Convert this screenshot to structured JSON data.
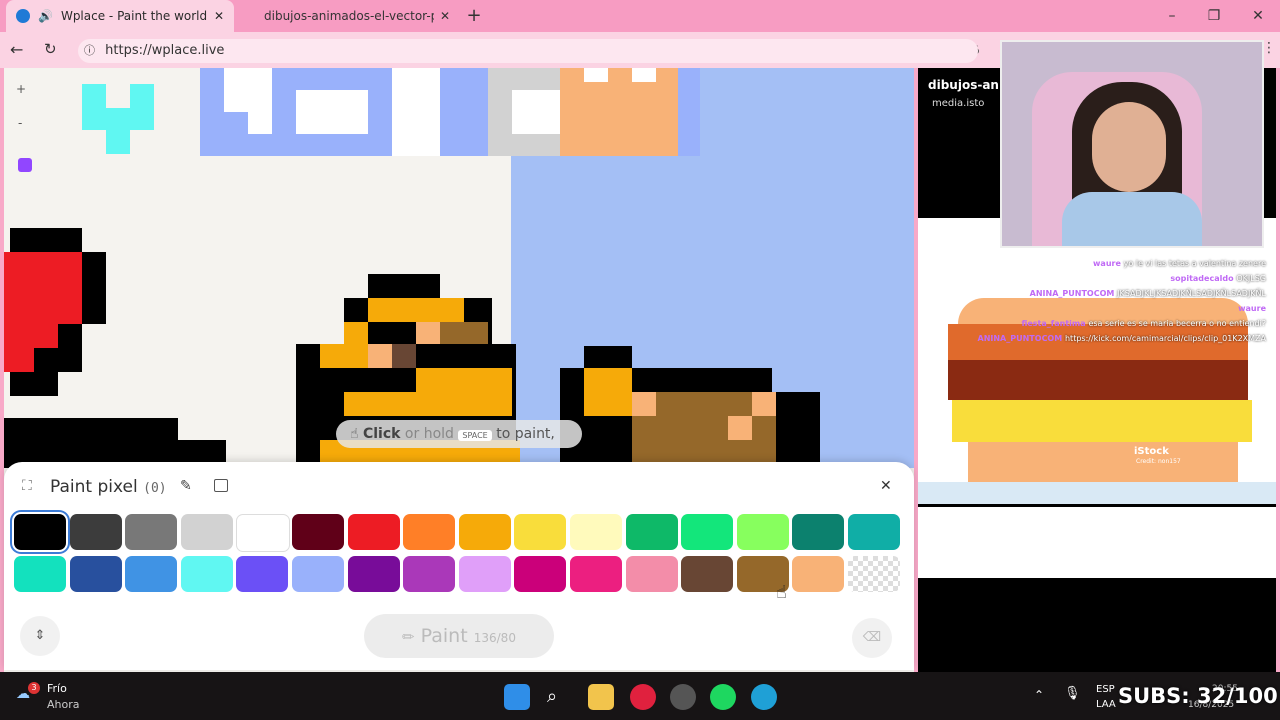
{
  "browser": {
    "tabs": [
      {
        "title": "Wplace - Paint the world"
      },
      {
        "title": "dibujos-animados-el-vector-pixel"
      }
    ],
    "url": "https://wplace.live",
    "new_tab_glyph": "+",
    "close_glyph": "✕"
  },
  "canvas": {
    "hint_click": "Click",
    "hint_or_hold": "or hold",
    "hint_space": "SPACE",
    "hint_to_paint": "to paint,"
  },
  "panel": {
    "title": "Paint pixel",
    "count": "(0)",
    "paint_label": "Paint",
    "paint_count": "136/80",
    "colors_row1": [
      "#000000",
      "#3c3c3c",
      "#787878",
      "#d2d2d2",
      "#ffffff",
      "#600018",
      "#ed1c24",
      "#ff7f27",
      "#f6aa09",
      "#f9dd3b",
      "#fffabc",
      "#0eb968",
      "#13e67b",
      "#87ff5e",
      "#0c816e",
      "#10aea6"
    ],
    "colors_row2": [
      "#13e1be",
      "#28509e",
      "#4093e4",
      "#60f7f2",
      "#6b50f6",
      "#99b1fb",
      "#780c99",
      "#aa38b9",
      "#e09ff9",
      "#cb007a",
      "#ec1f80",
      "#f38da9",
      "#684634",
      "#95682a",
      "#f8b277",
      "transparent"
    ]
  },
  "right": {
    "title": "dibujos-anim",
    "source": "media.isto",
    "istock": "iStock",
    "credit": "Credit: non157",
    "chat": [
      {
        "user": "waure",
        "msg": "yo le vi las tetas a valentina zenere"
      },
      {
        "user": "sopitadecaldo",
        "msg": "OKJLSG"
      },
      {
        "user": "ANINA_PUNTOCOM",
        "msg": "JKSADJKLJKSADJKÑLSADJKÑLSADJKÑL"
      },
      {
        "user": "waure",
        "msg": ""
      },
      {
        "user": "fiesta_fantima",
        "msg": "esa serie es se maria becerra o no entiendi?"
      },
      {
        "user": "ANINA_PUNTOCOM",
        "msg": "https://kick.com/camimarcial/clips/clip_01K2XMZA"
      }
    ]
  },
  "taskbar": {
    "weather_title": "Frío",
    "weather_sub": "Ahora",
    "weather_badge": "3",
    "lang1": "ESP",
    "lang2": "LAA",
    "subs": "SUBS: 32/100",
    "time": "20:55",
    "date": "16/8/2025"
  }
}
